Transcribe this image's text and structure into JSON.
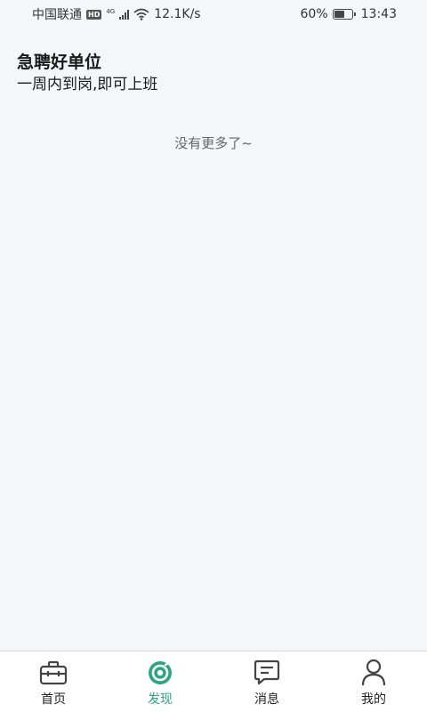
{
  "status_bar": {
    "carrier": "中国联通",
    "hd": "HD",
    "network": "4G",
    "speed": "12.1K/s",
    "battery_percent": "60%",
    "battery_level": 0.6,
    "time": "13:43"
  },
  "banner": {
    "title": "急聘好单位",
    "subtitle": "一周内到岗,即可上班"
  },
  "list": {
    "empty_tip": "没有更多了~"
  },
  "tabs": [
    {
      "label": "首页",
      "icon": "briefcase-icon",
      "active": false
    },
    {
      "label": "发现",
      "icon": "discover-icon",
      "active": true
    },
    {
      "label": "消息",
      "icon": "message-icon",
      "active": false
    },
    {
      "label": "我的",
      "icon": "user-icon",
      "active": false
    }
  ],
  "colors": {
    "accent": "#2ba582",
    "background": "#f5f6fa"
  }
}
